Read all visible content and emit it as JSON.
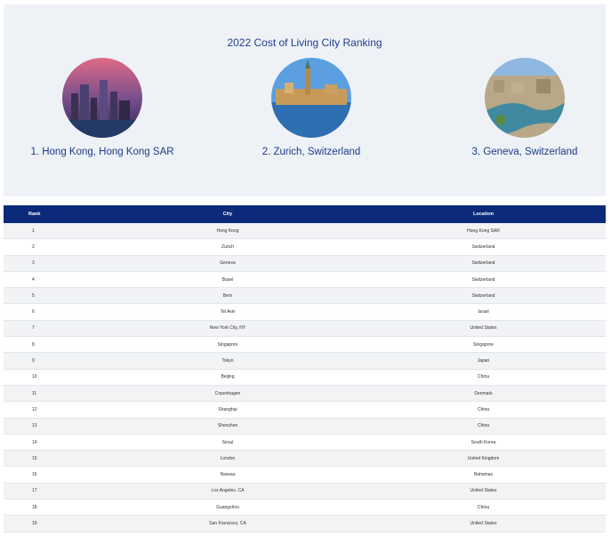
{
  "hero": {
    "title": "2022 Cost of Living City Ranking",
    "cities": [
      {
        "caption": "1. Hong Kong, Hong Kong SAR",
        "image": "hong-kong-skyline-photo"
      },
      {
        "caption": "2. Zurich, Switzerland",
        "image": "zurich-riverside-photo"
      },
      {
        "caption": "3. Geneva, Switzerland",
        "image": "geneva-lake-aerial-photo"
      }
    ]
  },
  "table": {
    "headers": {
      "rank": "Rank",
      "city": "City",
      "location": "Location"
    },
    "rows": [
      {
        "rank": "1",
        "city": "Hong Kong",
        "location": "Hong Kong SAR"
      },
      {
        "rank": "2",
        "city": "Zurich",
        "location": "Switzerland"
      },
      {
        "rank": "3",
        "city": "Geneva",
        "location": "Switzerland"
      },
      {
        "rank": "4",
        "city": "Basel",
        "location": "Switzerland"
      },
      {
        "rank": "5",
        "city": "Bern",
        "location": "Switzerland"
      },
      {
        "rank": "6",
        "city": "Tel Aviv",
        "location": "Israel"
      },
      {
        "rank": "7",
        "city": "New York City, NY",
        "location": "United States"
      },
      {
        "rank": "8",
        "city": "Singapore",
        "location": "Singapore"
      },
      {
        "rank": "9",
        "city": "Tokyo",
        "location": "Japan"
      },
      {
        "rank": "10",
        "city": "Beijing",
        "location": "China"
      },
      {
        "rank": "11",
        "city": "Copenhagen",
        "location": "Denmark"
      },
      {
        "rank": "12",
        "city": "Shanghai",
        "location": "China"
      },
      {
        "rank": "13",
        "city": "Shenzhen",
        "location": "China"
      },
      {
        "rank": "14",
        "city": "Seoul",
        "location": "South Korea"
      },
      {
        "rank": "15",
        "city": "London",
        "location": "United Kingdom"
      },
      {
        "rank": "16",
        "city": "Nassau",
        "location": "Bahamas"
      },
      {
        "rank": "17",
        "city": "Los Angeles, CA",
        "location": "United States"
      },
      {
        "rank": "18",
        "city": "Guangzhou",
        "location": "China"
      },
      {
        "rank": "19",
        "city": "San Francisco, CA",
        "location": "United States"
      }
    ]
  }
}
